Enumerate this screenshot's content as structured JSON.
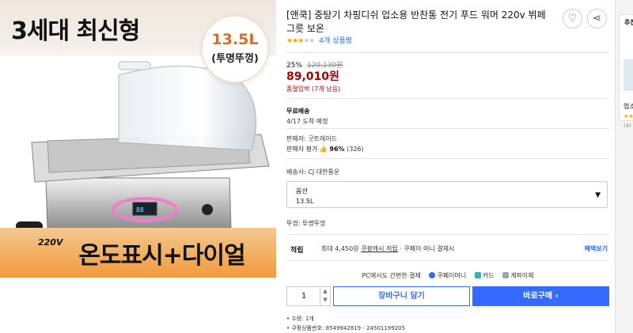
{
  "product_image": {
    "headline": "3세대 최신형",
    "badge_size": "13.5L",
    "badge_sub": "(투명뚜껑)",
    "slogan": "온도표시+다이얼",
    "voltage": "220V"
  },
  "product": {
    "title": "[앤쿡] 중탕기 차핑디쉬 업소용 반찬통 전기 푸드 워머 220v 뷔페 그릇 보온",
    "rating_stars": 3.5,
    "rating_count": "4개 상품평",
    "discount": "25%",
    "original_price": "120,130원",
    "price": "89,010원",
    "stock_notice": "품절임박 (7개 남음)",
    "shipping": "무료배송",
    "arrival": "4/17 도착 예정",
    "seller": "판매자: 굿트레이드",
    "seller_rating_label": "판매자 평가",
    "seller_rating_value": "96%",
    "seller_rating_count": "(326)",
    "ship_from": "배송사: CJ 대한통운",
    "option_label": "옵션",
    "option_value": "13.5L",
    "lid": "뚜껑: 투명뚜껑",
    "point_label": "적립",
    "point_text": "최대 4,450원",
    "point_link": "쿠팡캐시 적립",
    "point_suffix": "· 쿠페이 머니 결제시",
    "benefit_link": "혜택보기",
    "pay_intro": "PC에서도 간편한 결제",
    "pay_methods": [
      "쿠페이머니",
      "카드",
      "계좌이체"
    ],
    "quantity": "1",
    "cart_button": "장바구니 담기",
    "buy_button": "바로구매",
    "info_qty": "• 수량: 1개",
    "info_code": "• 쿠팡상품번호: 8549942819 - 24501199205"
  },
  "side_panel": {
    "title": "추천",
    "line": "업소",
    "stars": "★★★",
    "count": "(4)"
  },
  "colors": {
    "accent": "#346aff",
    "price_red": "#ae0000",
    "star": "#f0a30a",
    "banner_orange": "#f19a3c"
  }
}
